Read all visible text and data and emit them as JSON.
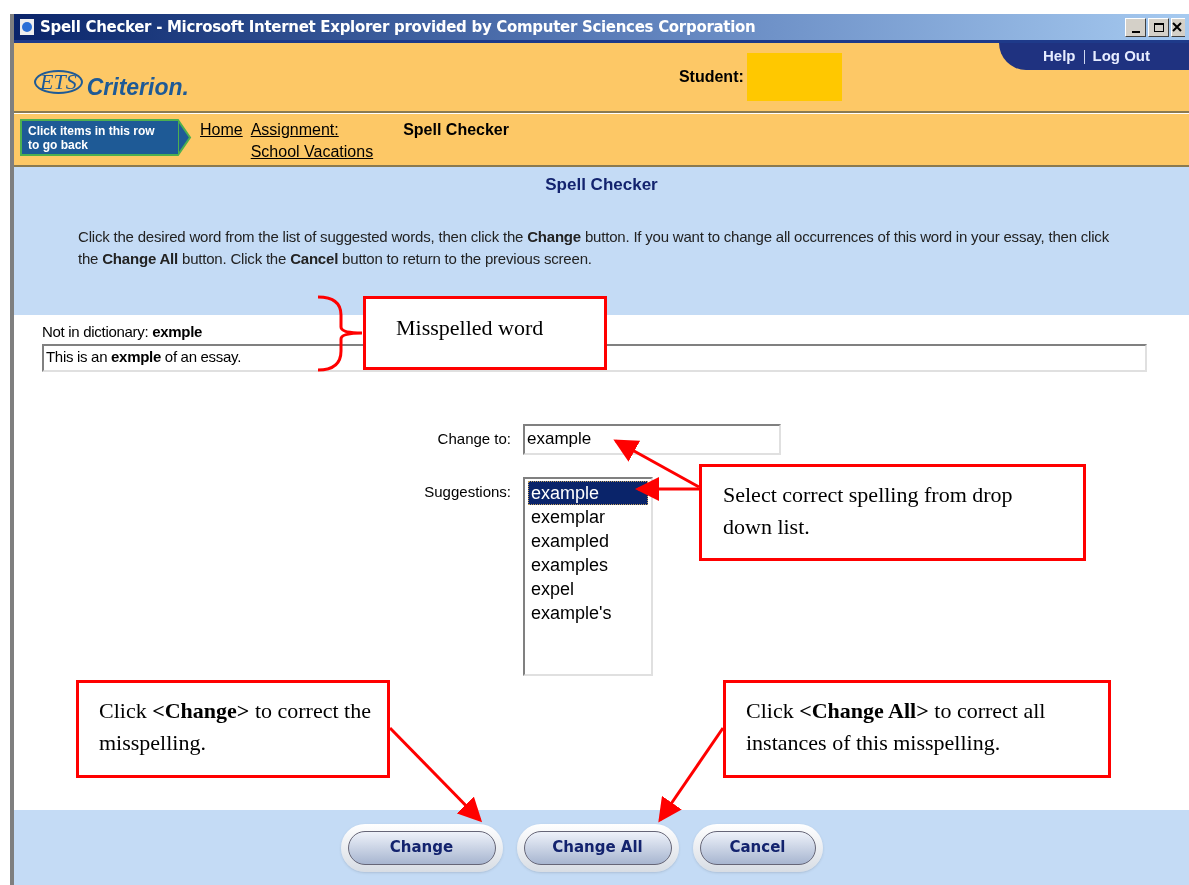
{
  "window": {
    "title": "Spell Checker - Microsoft Internet Explorer provided by Computer Sciences Corporation"
  },
  "header": {
    "logo_mark": "ETS",
    "logo_name": "Criterion.",
    "student_label": "Student:",
    "links": [
      "Help",
      "Log Out"
    ]
  },
  "breadcrumb": {
    "hint": "Click items in this row to go back",
    "links": [
      {
        "label": "Home"
      },
      {
        "label": "Assignment:\nSchool Vacations"
      }
    ],
    "current": "Spell Checker"
  },
  "intro": {
    "heading": "Spell Checker",
    "instructions": "Click the desired word from the list of suggested words, then click the **Change** button. If you want to change all occurrences of this word in your essay, then click the **Change All** button. Click the **Cancel** button to return to the previous screen."
  },
  "checker": {
    "not_in_dictionary": "Not in dictionary: **exmple**",
    "context": "This is an **exmple** of an essay.",
    "change_to_label": "Change to:",
    "change_to_value": "example",
    "suggestions_label": "Suggestions:",
    "suggestions": [
      {
        "label": "example",
        "selected": true
      },
      {
        "label": "exemplar",
        "selected": false
      },
      {
        "label": "exampled",
        "selected": false
      },
      {
        "label": "examples",
        "selected": false
      },
      {
        "label": "expel",
        "selected": false
      },
      {
        "label": "example's",
        "selected": false
      }
    ]
  },
  "buttons": [
    "Change",
    "Change All",
    "Cancel"
  ],
  "annotations": [
    "Misspelled word",
    "Select correct spelling from drop down list.",
    "Click **<Change>** to correct the misspelling.",
    "Click **<Change All>** to correct all instances of this misspelling."
  ]
}
